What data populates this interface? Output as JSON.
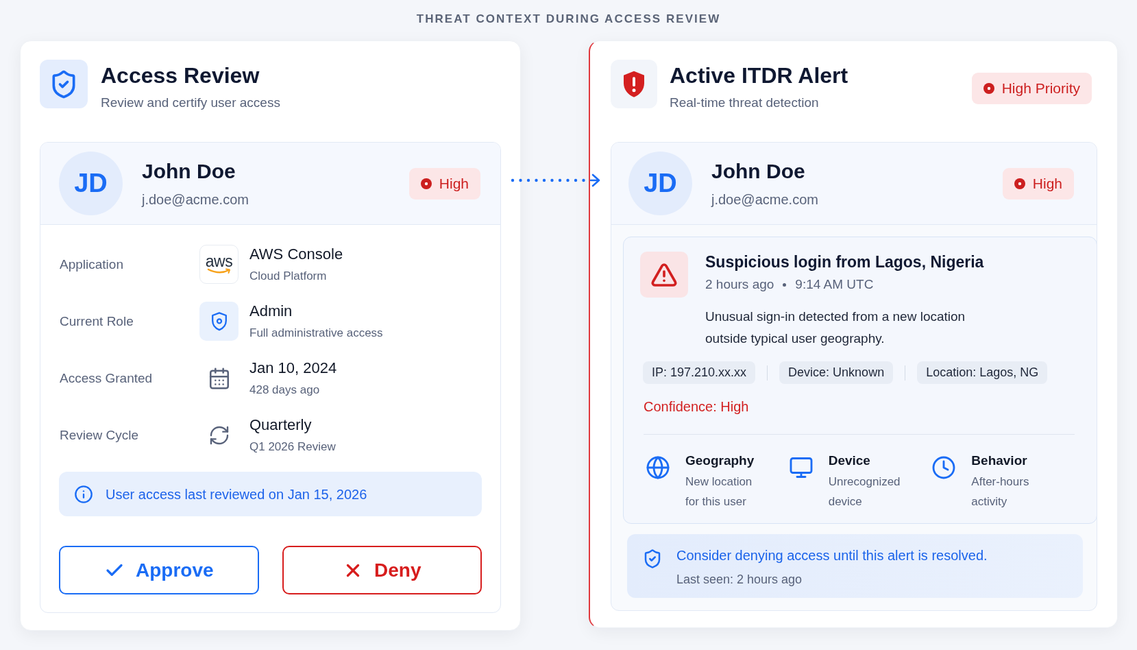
{
  "heading": "THREAT CONTEXT DURING ACCESS REVIEW",
  "access_review": {
    "title": "Access Review",
    "subtitle": "Review and certify user access",
    "user": {
      "initials": "JD",
      "name": "John Doe",
      "email": "j.doe@acme.com",
      "risk": "High"
    },
    "details": [
      {
        "kind": "logo",
        "label": "Application",
        "logo_text": "aws",
        "value": "AWS Console",
        "note": "Cloud Platform"
      },
      {
        "kind": "role",
        "label": "Current Role",
        "value": "Admin",
        "note": "Full administrative access"
      },
      {
        "kind": "date",
        "label": "Access Granted",
        "value": "Jan 10, 2024",
        "note": "428 days ago"
      },
      {
        "kind": "cycle",
        "label": "Review Cycle",
        "value": "Quarterly",
        "note": "Q1 2026 Review"
      }
    ],
    "info": "User access last reviewed on Jan 15, 2026",
    "buttons": [
      {
        "kind": "approve",
        "label": "Approve"
      },
      {
        "kind": "deny",
        "label": "Deny"
      }
    ]
  },
  "itdr_alert": {
    "title": "Active ITDR Alert",
    "subtitle": "Real-time threat detection",
    "priority": "High Priority",
    "user": {
      "initials": "JD",
      "name": "John Doe",
      "email": "j.doe@acme.com",
      "risk": "High"
    },
    "alert": {
      "title": "Suspicious login from Lagos, Nigeria",
      "time_ago": "2 hours ago",
      "time": "9:14 AM UTC",
      "description": "Unusual sign-in detected from a new location outside typical user geography.",
      "tags": [
        "IP: 197.210.xx.xx",
        "Device: Unknown",
        "Location: Lagos, NG"
      ],
      "confidence": "Confidence: High",
      "factors": [
        {
          "kind": "geography",
          "title": "Geography",
          "detail": "New location for this user"
        },
        {
          "kind": "device",
          "title": "Device",
          "detail": "Unrecognized device"
        },
        {
          "kind": "behavior",
          "title": "Behavior",
          "detail": "After-hours activity"
        }
      ]
    },
    "recommendation": {
      "text": "Consider denying access until this alert is resolved.",
      "last_seen": "Last seen: 2 hours ago"
    }
  }
}
